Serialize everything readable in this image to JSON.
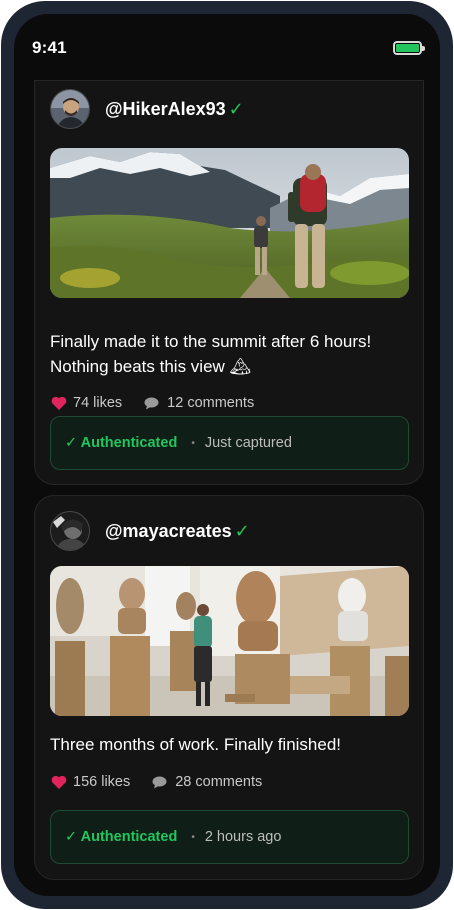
{
  "status_bar": {
    "time": "9:41",
    "battery_icon": "battery-icon"
  },
  "posts": [
    {
      "username": "@HikerAlex93",
      "verified_mark": "✓",
      "photo_subject": "hikers-mountain-trail",
      "caption": "Finally made it to the summit after 6 hours! Nothing beats this view 🏔",
      "likes": "74 likes",
      "comments": "12 comments",
      "auth_status": "✓ Authenticated",
      "auth_separator": "•",
      "auth_time": "Just captured"
    },
    {
      "username": "@mayacreates",
      "verified_mark": "✓",
      "photo_subject": "sculpture-studio",
      "caption": "Three months of work. Finally finished!",
      "likes": "156 likes",
      "comments": "28 comments",
      "auth_status": "✓ Authenticated",
      "auth_separator": "•",
      "auth_time": "2 hours ago"
    }
  ],
  "colors": {
    "accent_green": "#22c55e",
    "heart_red": "#e0245e",
    "screen_bg": "#0b0b0b",
    "card_bg": "#141414",
    "auth_bg": "#0f1e17"
  }
}
